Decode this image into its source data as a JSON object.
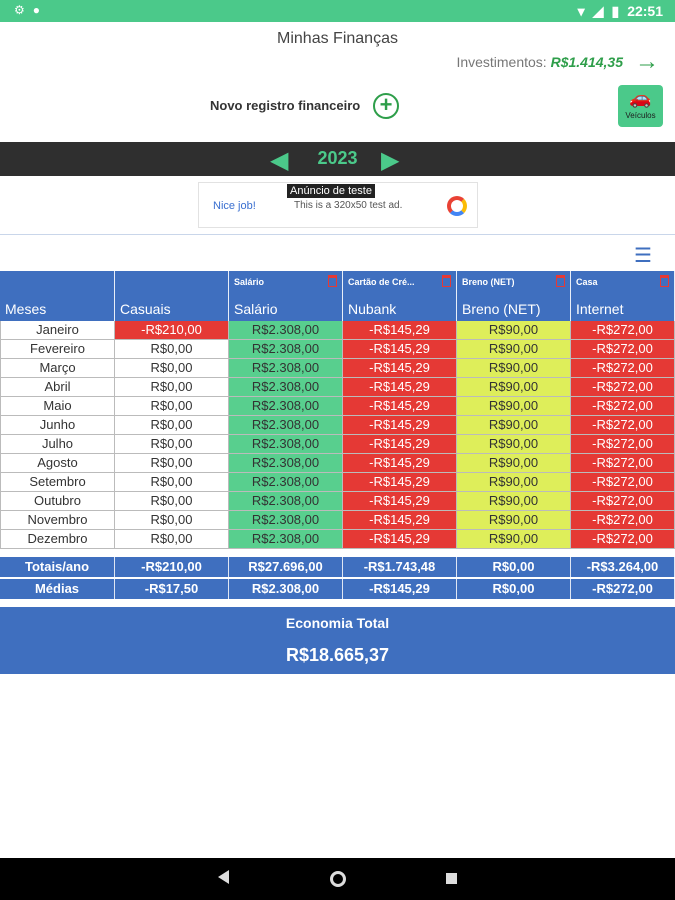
{
  "status_bar": {
    "time": "22:51",
    "left_icons": [
      "gear-icon",
      "circle-icon"
    ],
    "right_icons": [
      "wifi-icon",
      "signal-icon",
      "battery-icon"
    ]
  },
  "header": {
    "title": "Minhas Finanças",
    "investments_label": "Investimentos:",
    "investments_value": "R$1.414,35",
    "new_record_label": "Novo registro financeiro",
    "vehicles_label": "Veículos"
  },
  "year": "2023",
  "ad": {
    "tooltip": "Anúncio de teste",
    "nice": "Nice job!",
    "text": "This is a 320x50 test ad."
  },
  "columns": [
    {
      "small": "",
      "label": "Meses",
      "trash": false
    },
    {
      "small": "",
      "label": "Casuais",
      "trash": false
    },
    {
      "small": "Salário",
      "label": "Salário",
      "trash": true
    },
    {
      "small": "Cartão de Cré...",
      "label": "Nubank",
      "trash": true
    },
    {
      "small": "Breno (NET)",
      "label": "Breno (NET)",
      "trash": true
    },
    {
      "small": "Casa",
      "label": "Internet",
      "trash": true
    }
  ],
  "rows": [
    [
      "Janeiro",
      "-R$210,00",
      "R$2.308,00",
      "-R$145,29",
      "R$90,00",
      "-R$272,00"
    ],
    [
      "Fevereiro",
      "R$0,00",
      "R$2.308,00",
      "-R$145,29",
      "R$90,00",
      "-R$272,00"
    ],
    [
      "Março",
      "R$0,00",
      "R$2.308,00",
      "-R$145,29",
      "R$90,00",
      "-R$272,00"
    ],
    [
      "Abril",
      "R$0,00",
      "R$2.308,00",
      "-R$145,29",
      "R$90,00",
      "-R$272,00"
    ],
    [
      "Maio",
      "R$0,00",
      "R$2.308,00",
      "-R$145,29",
      "R$90,00",
      "-R$272,00"
    ],
    [
      "Junho",
      "R$0,00",
      "R$2.308,00",
      "-R$145,29",
      "R$90,00",
      "-R$272,00"
    ],
    [
      "Julho",
      "R$0,00",
      "R$2.308,00",
      "-R$145,29",
      "R$90,00",
      "-R$272,00"
    ],
    [
      "Agosto",
      "R$0,00",
      "R$2.308,00",
      "-R$145,29",
      "R$90,00",
      "-R$272,00"
    ],
    [
      "Setembro",
      "R$0,00",
      "R$2.308,00",
      "-R$145,29",
      "R$90,00",
      "-R$272,00"
    ],
    [
      "Outubro",
      "R$0,00",
      "R$2.308,00",
      "-R$145,29",
      "R$90,00",
      "-R$272,00"
    ],
    [
      "Novembro",
      "R$0,00",
      "R$2.308,00",
      "-R$145,29",
      "R$90,00",
      "-R$272,00"
    ],
    [
      "Dezembro",
      "R$0,00",
      "R$2.308,00",
      "-R$145,29",
      "R$90,00",
      "-R$272,00"
    ]
  ],
  "totals": [
    "Totais/ano",
    "-R$210,00",
    "R$27.696,00",
    "-R$1.743,48",
    "R$0,00",
    "-R$3.264,00"
  ],
  "averages": [
    "Médias",
    "-R$17,50",
    "R$2.308,00",
    "-R$145,29",
    "R$0,00",
    "-R$272,00"
  ],
  "economy": {
    "title": "Economia Total",
    "value": "R$18.665,37"
  },
  "colors": {
    "accent_green": "#4bc98a",
    "header_blue": "#3f6fbf",
    "negative_red": "#e53935",
    "neutral_yellow": "#deee5a"
  }
}
